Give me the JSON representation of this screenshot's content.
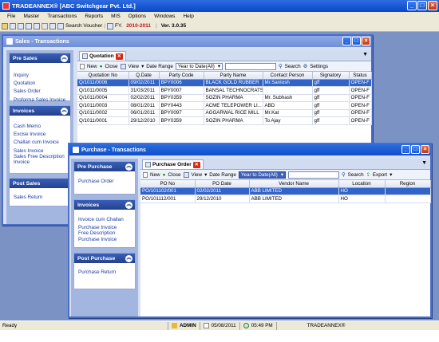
{
  "app": {
    "title": "TRADEANNEX® [ABC Switchgear Pvt. Ltd.]"
  },
  "menu": [
    "File",
    "Master",
    "Transactions",
    "Reports",
    "MIS",
    "Options",
    "Windows",
    "Help"
  ],
  "toolbar": {
    "search_voucher": "Search Voucher",
    "fy_label": "FY.",
    "fy_value": "2010-2011",
    "version": "Ver. 3.0.35"
  },
  "sales_window": {
    "title": "Sales - Transactions",
    "sections": [
      {
        "header": "Pre Sales",
        "items": [
          "Inquiry",
          "Quotation",
          "Sales Order",
          "Proforma Sales Invoice"
        ]
      },
      {
        "header": "Invoices",
        "items": [
          "Cash Memo",
          "Excise Invoice",
          "Challan cum Invoice",
          "Sales Invoice",
          "Sales Free Description",
          "Invoice"
        ]
      },
      {
        "header": "Post Sales",
        "items": [
          "Sales Return"
        ]
      }
    ],
    "tab_label": "Quotation",
    "grid_toolbar": {
      "new": "New",
      "close": "Close",
      "view": "View",
      "date_range_label": "Date Range",
      "date_range_value": "Year to Date(All)",
      "search": "Search",
      "settings": "Settings"
    },
    "columns": [
      "Quotation No",
      "Q.Date",
      "Party Code",
      "Party Name",
      "Contact Person",
      "Signatory",
      "Status"
    ],
    "rows": [
      [
        "Q/1011/0006",
        "09/02/2011",
        "BPY0006",
        "BLACK GOLD RUBBER",
        "Mr.Santosh",
        "gff",
        "OPEN-F"
      ],
      [
        "Q/1011/0005",
        "31/03/2011",
        "BPY0007",
        "BANSAL TECHNOCRATS",
        "",
        "gff",
        "OPEN-F"
      ],
      [
        "Q/1011/0004",
        "02/02/2011",
        "BPY0359",
        "SOZIN PHARMA",
        "Mr. Subhash",
        "gff",
        "OPEN-F"
      ],
      [
        "Q/1011/0003",
        "08/01/2011",
        "BPY0443",
        "ACME TELEPOWER LI...",
        "ABD",
        "gff",
        "OPEN-F"
      ],
      [
        "Q/1011/0002",
        "06/01/2011",
        "BPY0097",
        "AGGARWAL RICE MILL",
        "Mr.Kat",
        "gff",
        "OPEN-F"
      ],
      [
        "Q/1011/0001",
        "29/12/2010",
        "BPY0359",
        "SOZIN PHARMA",
        "To Ajay",
        "gff",
        "OPEN-F"
      ]
    ]
  },
  "purchase_window": {
    "title": "Purchase - Transactions",
    "sections": [
      {
        "header": "Pre Purchase",
        "items": [
          "Purchase Order"
        ]
      },
      {
        "header": "Invoices",
        "items": [
          "Invoice cum Challan",
          "Purchase Invoice",
          "Free Description",
          "Purchase Invoice"
        ]
      },
      {
        "header": "Post Purchase",
        "items": [
          "Purchase Return"
        ]
      }
    ],
    "tab_label": "Purchase Order",
    "grid_toolbar": {
      "new": "New",
      "close": "Close",
      "view": "View",
      "date_range_label": "Date Range",
      "date_range_value": "Year to Date(All)",
      "search": "Search",
      "export": "Export"
    },
    "columns": [
      "PO No",
      "PO Date",
      "Vendor Name",
      "Location",
      "Region"
    ],
    "rows": [
      [
        "PO/101102/001",
        "02/02/2011",
        "ABB LIMITED",
        "HO",
        ""
      ],
      [
        "PO/101112/001",
        "29/12/2010",
        "ABB LIMITED",
        "HO",
        ""
      ]
    ]
  },
  "status": {
    "ready": "Ready",
    "user": "ADMIN",
    "date": "05/08/2011",
    "time": "05:49 PM",
    "app": "TRADEANNEX®"
  },
  "colors": {
    "accent": "#3163c9",
    "fy": "#c0101a"
  }
}
